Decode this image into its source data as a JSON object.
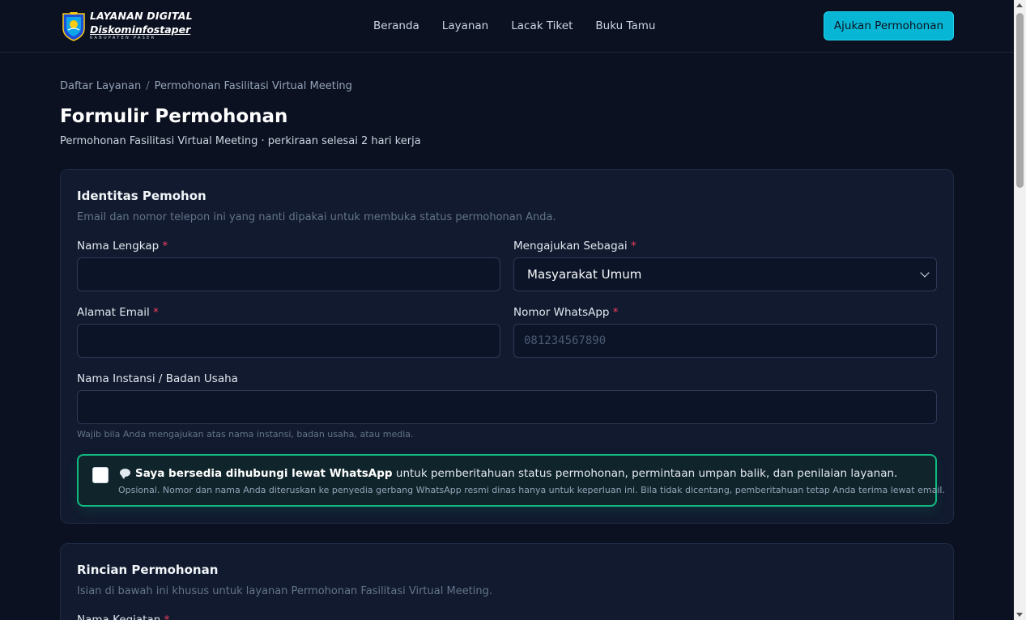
{
  "header": {
    "logo": {
      "line1": "LAYANAN DIGITAL",
      "line2": "Diskominfostaper",
      "line3": "KABUPATEN PASER"
    },
    "nav": [
      "Beranda",
      "Layanan",
      "Lacak Tiket",
      "Buku Tamu"
    ],
    "cta_label": "Ajukan Permohonan"
  },
  "breadcrumb": {
    "root": "Daftar Layanan",
    "separator": "/",
    "current": "Permohonan Fasilitasi Virtual Meeting"
  },
  "page": {
    "title": "Formulir Permohonan",
    "subtitle": "Permohonan Fasilitasi Virtual Meeting · perkiraan selesai 2 hari kerja"
  },
  "identity": {
    "title": "Identitas Pemohon",
    "description": "Email dan nomor telepon ini yang nanti dipakai untuk membuka status permohonan Anda.",
    "required_mark": "*",
    "name": {
      "label": "Nama Lengkap",
      "value": "",
      "placeholder": ""
    },
    "role": {
      "label": "Mengajukan Sebagai",
      "value": "Masyarakat Umum"
    },
    "email": {
      "label": "Alamat Email",
      "value": "",
      "placeholder": ""
    },
    "whatsapp": {
      "label": "Nomor WhatsApp",
      "value": "",
      "placeholder": "081234567890"
    },
    "institution": {
      "label": "Nama Instansi / Badan Usaha",
      "value": "",
      "placeholder": "",
      "hint": "Wajib bila Anda mengajukan atas nama instansi, badan usaha, atau media."
    },
    "consent": {
      "checked": false,
      "icon": "speech-bubble-icon",
      "bold_text": "Saya bersedia dihubungi lewat WhatsApp",
      "text": " untuk pemberitahuan status permohonan, permintaan umpan balik, dan penilaian layanan.",
      "note": "Opsional. Nomor dan nama Anda diteruskan ke penyedia gerbang WhatsApp resmi dinas hanya untuk keperluan ini. Bila tidak dicentang, pemberitahuan tetap Anda terima lewat email."
    }
  },
  "details": {
    "title": "Rincian Permohonan",
    "description": "Isian di bawah ini khusus untuk layanan Permohonan Fasilitasi Virtual Meeting.",
    "activity_label": "Nama Kegiatan",
    "required_mark": "*"
  },
  "colors": {
    "background": "#0b1120",
    "card": "#111a2e",
    "accent": "#06b6d4",
    "required": "#f43f5e",
    "consent_border": "#10b981"
  }
}
